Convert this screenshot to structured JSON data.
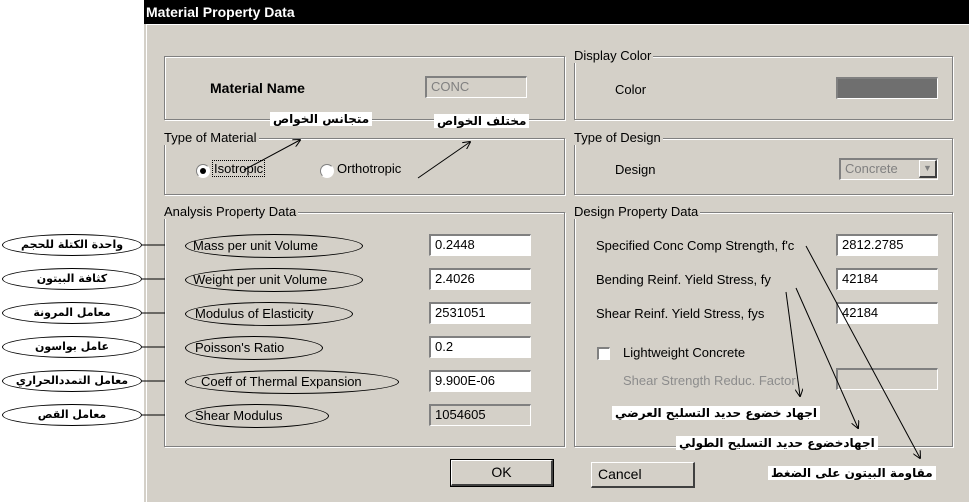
{
  "window": {
    "title": "Material Property Data"
  },
  "material": {
    "name_label": "Material Name",
    "name_value": "CONC"
  },
  "type_of_material": {
    "legend": "Type of Material",
    "isotropic": "Isotropic",
    "orthotropic": "Orthotropic",
    "selected": "Isotropic"
  },
  "analysis": {
    "legend": "Analysis Property Data",
    "rows": [
      {
        "label": "Mass per unit Volume",
        "value": "0.2448",
        "note": "واحدة الكتلة للحجم"
      },
      {
        "label": "Weight per unit Volume",
        "value": "2.4026",
        "note": "كثافة البيتون"
      },
      {
        "label": "Modulus of Elasticity",
        "value": "2531051",
        "note": "معامل المرونة"
      },
      {
        "label": "Poisson's Ratio",
        "value": "0.2",
        "note": "عامل بواسون"
      },
      {
        "label": "Coeff of Thermal Expansion",
        "value": "9.900E-06",
        "note": "معامل التمددالحراري"
      },
      {
        "label": "Shear Modulus",
        "value": "1054605",
        "note": "معامل القص"
      }
    ]
  },
  "display_color": {
    "legend": "Display Color",
    "label": "Color",
    "swatch_color": "#6f6f6f"
  },
  "type_of_design": {
    "legend": "Type of Design",
    "label": "Design",
    "value": "Concrete"
  },
  "design": {
    "legend": "Design Property Data",
    "fc_label": "Specified Conc Comp Strength, f'c",
    "fc_value": "2812.2785",
    "fy_label": "Bending Reinf. Yield Stress, fy",
    "fy_value": "42184",
    "fys_label": "Shear Reinf. Yield Stress, fys",
    "fys_value": "42184",
    "lightweight_label": "Lightweight Concrete",
    "shear_reduc_label": "Shear Strength Reduc. Factor",
    "shear_reduc_value": ""
  },
  "buttons": {
    "ok": "OK",
    "cancel": "Cancel"
  },
  "annotations": {
    "isotropic": "متجانس الخواص",
    "orthotropic": "مختلف الخواص",
    "fys": "اجهاد خضوع حديد التسليح العرضي",
    "fy": "اجهادخضوع حديد التسليح الطولي",
    "fc": "مقاومة البيتون على الضغط"
  }
}
